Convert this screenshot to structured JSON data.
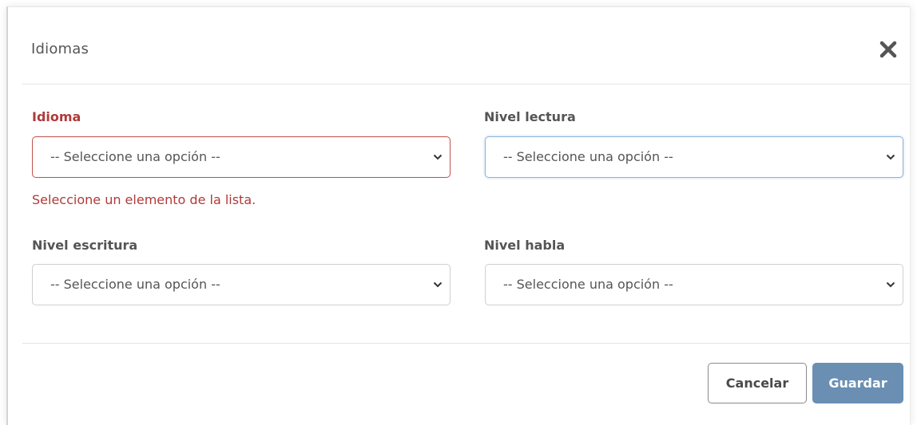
{
  "modal": {
    "title": "Idiomas",
    "close_icon": "close-icon"
  },
  "fields": {
    "idioma": {
      "label": "Idioma",
      "value": "-- Seleccione una opción --",
      "error": "Seleccione un elemento de la lista."
    },
    "nivel_lectura": {
      "label": "Nivel lectura",
      "value": "-- Seleccione una opción --"
    },
    "nivel_escritura": {
      "label": "Nivel escritura",
      "value": "-- Seleccione una opción --"
    },
    "nivel_habla": {
      "label": "Nivel habla",
      "value": "-- Seleccione una opción --"
    }
  },
  "footer": {
    "cancel_label": "Cancelar",
    "save_label": "Guardar"
  },
  "colors": {
    "error": "#b03a3a",
    "primary_button": "#6a8fb3",
    "focus_border": "#8cb4dc"
  }
}
